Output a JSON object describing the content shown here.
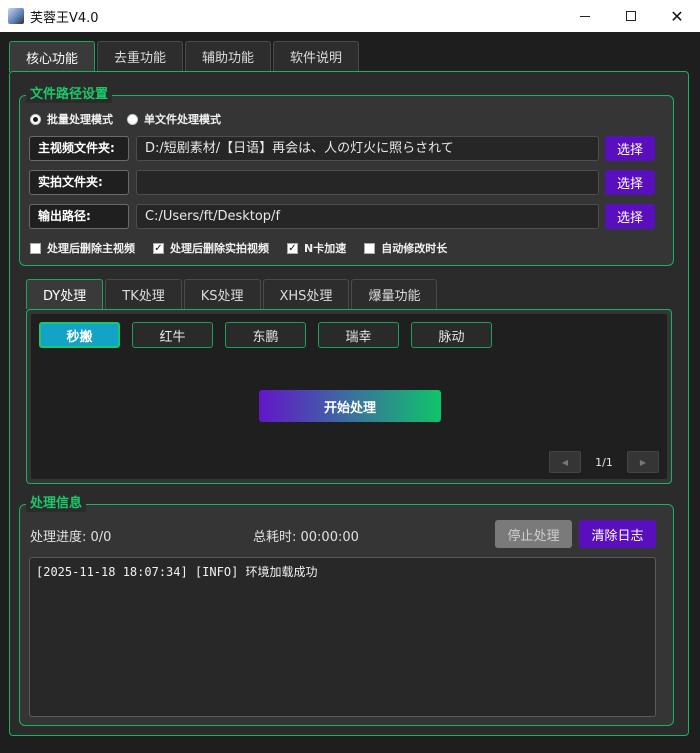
{
  "window": {
    "title": "芙蓉王V4.0",
    "controls": [
      "minimize",
      "maximize",
      "close"
    ]
  },
  "main_tabs": [
    {
      "label": "核心功能",
      "active": true
    },
    {
      "label": "去重功能",
      "active": false
    },
    {
      "label": "辅助功能",
      "active": false
    },
    {
      "label": "软件说明",
      "active": false
    }
  ],
  "paths_group": {
    "title": "文件路径设置",
    "modes": [
      {
        "label": "批量处理模式",
        "checked": true
      },
      {
        "label": "单文件处理模式",
        "checked": false
      }
    ],
    "rows": [
      {
        "label": "主视频文件夹:",
        "value": "D:/短剧素材/【日语】再会は、人の灯火に照らされて",
        "button": "选择"
      },
      {
        "label": "实拍文件夹:",
        "value": "",
        "button": "选择"
      },
      {
        "label": "输出路径:",
        "value": "C:/Users/ft/Desktop/f",
        "button": "选择"
      }
    ],
    "options": [
      {
        "label": "处理后删除主视频",
        "checked": false
      },
      {
        "label": "处理后删除实拍视频",
        "checked": true
      },
      {
        "label": "N卡加速",
        "checked": true
      },
      {
        "label": "自动修改时长",
        "checked": false
      }
    ]
  },
  "sub_tabs": [
    {
      "label": "DY处理",
      "active": true
    },
    {
      "label": "TK处理",
      "active": false
    },
    {
      "label": "KS处理",
      "active": false
    },
    {
      "label": "XHS处理",
      "active": false
    },
    {
      "label": "爆量功能",
      "active": false
    }
  ],
  "platforms": [
    {
      "label": "秒搬",
      "active": true
    },
    {
      "label": "红牛",
      "active": false
    },
    {
      "label": "东鹏",
      "active": false
    },
    {
      "label": "瑞幸",
      "active": false
    },
    {
      "label": "脉动",
      "active": false
    }
  ],
  "start_button": "开始处理",
  "pager": {
    "text": "1/1",
    "prev": "◀",
    "next": "▶"
  },
  "log_group": {
    "title": "处理信息",
    "progress": "处理进度: 0/0",
    "elapsed": "总耗时: 00:00:00",
    "stop_button": "停止处理",
    "clear_button": "清除日志",
    "lines": [
      "[2025-11-18 18:07:34] [INFO] 环境加载成功"
    ]
  },
  "colors": {
    "accent_green": "#17b35f",
    "accent_purple": "#5a0fbf",
    "active_platform": "#12a3c7",
    "background": "#1e1e1e"
  }
}
